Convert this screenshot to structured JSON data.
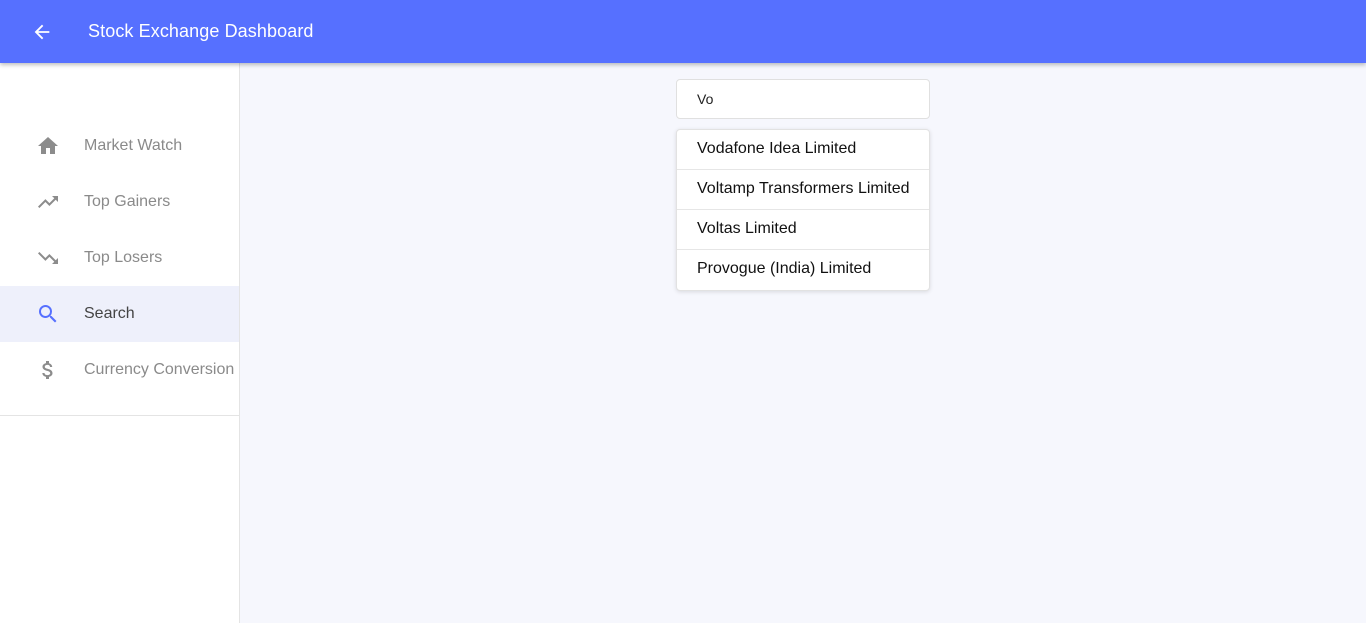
{
  "header": {
    "title": "Stock Exchange Dashboard",
    "back_icon": "arrow-left-icon",
    "background_color": "#5670ff"
  },
  "sidebar": {
    "items": [
      {
        "label": "Market Watch",
        "icon": "home-icon",
        "active": false
      },
      {
        "label": "Top Gainers",
        "icon": "trending-up-icon",
        "active": false
      },
      {
        "label": "Top Losers",
        "icon": "trending-down-icon",
        "active": false
      },
      {
        "label": "Search",
        "icon": "search-icon",
        "active": true
      },
      {
        "label": "Currency Conversion",
        "icon": "dollar-icon",
        "active": false
      }
    ],
    "active_color": "#5670ff"
  },
  "search": {
    "value": "Vo",
    "suggestions": [
      "Vodafone Idea Limited",
      "Voltamp Transformers Limited",
      "Voltas Limited",
      "Provogue (India) Limited"
    ]
  }
}
